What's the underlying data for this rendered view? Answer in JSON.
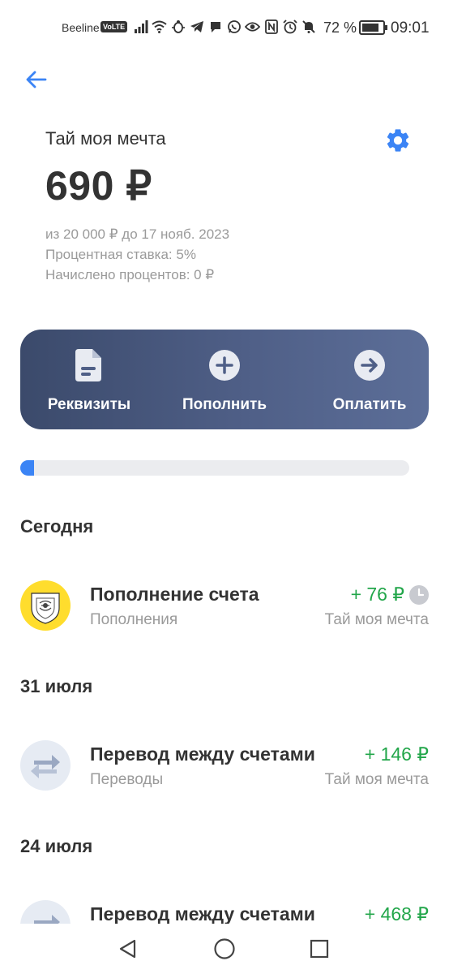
{
  "status_bar": {
    "carrier": "Beeline",
    "volte": "VoLTE",
    "battery": "72 %",
    "time": "09:01",
    "icons": [
      "signal-icon",
      "wifi-icon",
      "bug-icon",
      "telegram-icon",
      "chat-icon",
      "whatsapp-icon",
      "eye-icon",
      "nfc-icon",
      "alarm-icon",
      "mute-icon"
    ]
  },
  "header": {
    "title": "Тай моя мечта",
    "balance": "690 ₽",
    "target_line": "из 20 000 ₽ до 17 нояб. 2023",
    "rate_line": "Процентная ставка: 5%",
    "accrued_line": "Начислено процентов:  0 ₽"
  },
  "actions": {
    "requisites": "Реквизиты",
    "top_up": "Пополнить",
    "pay": "Оплатить"
  },
  "progress": {
    "fraction": 0.0345
  },
  "colors": {
    "accent": "#3b84f5",
    "positive": "#22a64a",
    "panel_start": "#3b4a6b",
    "panel_end": "#5c6e98",
    "muted": "#9a9a9a"
  },
  "sections": [
    {
      "title": "Сегодня",
      "transactions": [
        {
          "title": "Пополнение счета",
          "subtitle": "Пополнения",
          "amount": "+ 76 ₽",
          "account": "Тай моя мечта",
          "icon": "tinkoff-logo-icon",
          "pending": true
        }
      ]
    },
    {
      "title": "31 июля",
      "transactions": [
        {
          "title": "Перевод между счетами",
          "subtitle": "Переводы",
          "amount": "+ 146 ₽",
          "account": "Тай моя мечта",
          "icon": "transfer-arrows-icon",
          "pending": false
        }
      ]
    },
    {
      "title": "24 июля",
      "transactions": [
        {
          "title": "Перевод между счетами",
          "subtitle": "",
          "amount": "+ 468 ₽",
          "account": "",
          "icon": "transfer-arrows-icon",
          "pending": false
        }
      ]
    }
  ]
}
